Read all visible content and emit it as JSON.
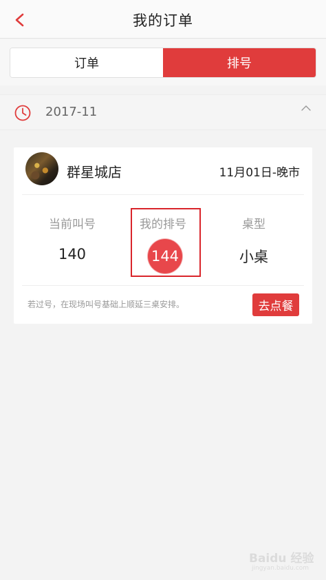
{
  "header": {
    "title": "我的订单",
    "back_icon": "chevron-left-icon"
  },
  "tabs": [
    {
      "label": "订单",
      "active": false
    },
    {
      "label": "排号",
      "active": true
    }
  ],
  "month_section": {
    "month": "2017-11",
    "icon": "clock-icon",
    "toggle_icon": "chevron-up-icon"
  },
  "ticket": {
    "store_name": "群星城店",
    "time": "11月01日-晚市",
    "stats": {
      "current_label": "当前叫号",
      "current_value": "140",
      "mine_label": "我的排号",
      "mine_value": "144",
      "type_label": "桌型",
      "type_value": "小桌"
    },
    "note": "若过号，在现场叫号基础上顺延三桌安排。",
    "order_button": "去点餐"
  },
  "colors": {
    "accent": "#e03c3c",
    "highlight": "#d9242a",
    "number_circle": "#e8474b"
  },
  "watermark": {
    "main": "Baidu 经验",
    "sub": "jingyan.baidu.com"
  }
}
